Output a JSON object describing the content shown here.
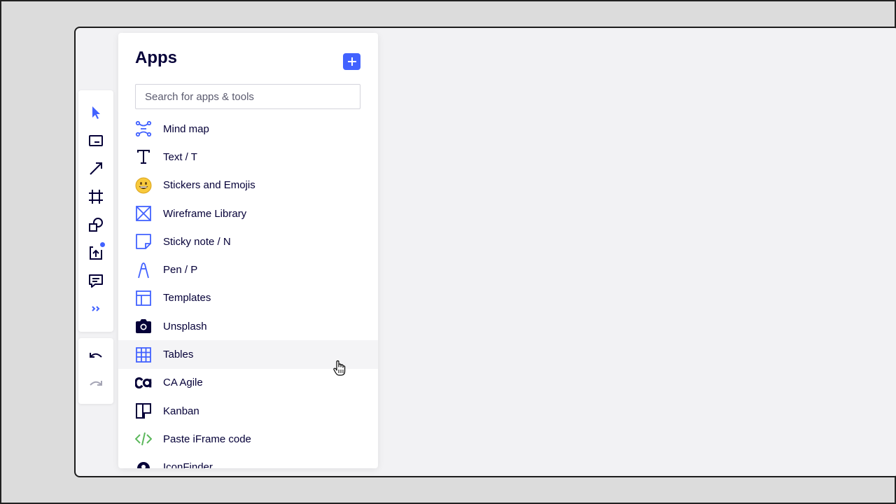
{
  "panel": {
    "title": "Apps",
    "add_button_icon": "plus-icon",
    "search_placeholder": "Search for apps & tools"
  },
  "toolbar": {
    "tools": [
      "select-icon",
      "text-frame-icon",
      "arrow-line-icon",
      "frame-icon",
      "shapes-icon",
      "upload-icon",
      "comment-icon",
      "more-chevrons-icon"
    ]
  },
  "history": {
    "tools": [
      "undo-icon",
      "redo-icon"
    ]
  },
  "apps": [
    {
      "label": "Mind map",
      "icon": "mind-map-icon"
    },
    {
      "label": "Text / T",
      "icon": "text-icon"
    },
    {
      "label": "Stickers and Emojis",
      "icon": "emoji-icon"
    },
    {
      "label": "Wireframe Library",
      "icon": "wireframe-icon"
    },
    {
      "label": "Sticky note / N",
      "icon": "sticky-note-icon"
    },
    {
      "label": "Pen / P",
      "icon": "pen-icon"
    },
    {
      "label": "Templates",
      "icon": "templates-icon"
    },
    {
      "label": "Unsplash",
      "icon": "camera-icon"
    },
    {
      "label": "Tables",
      "icon": "table-icon"
    },
    {
      "label": "CA Agile",
      "icon": "ca-agile-icon"
    },
    {
      "label": "Kanban",
      "icon": "kanban-icon"
    },
    {
      "label": "Paste iFrame code",
      "icon": "code-icon"
    },
    {
      "label": "IconFinder",
      "icon": "iconfinder-icon"
    }
  ],
  "colors": {
    "accent": "#4262ff",
    "text": "#050038",
    "code_green": "#5cb85c"
  }
}
